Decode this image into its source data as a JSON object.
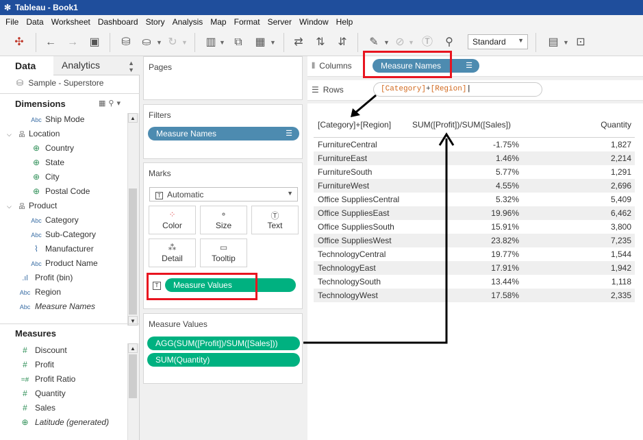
{
  "window": {
    "title": "Tableau - Book1"
  },
  "menu": [
    "File",
    "Data",
    "Worksheet",
    "Dashboard",
    "Story",
    "Analysis",
    "Map",
    "Format",
    "Server",
    "Window",
    "Help"
  ],
  "toolbar": {
    "view_mode": "Standard"
  },
  "data_pane": {
    "tab_data": "Data",
    "tab_analytics": "Analytics",
    "datasource": "Sample - Superstore",
    "dimensions_title": "Dimensions",
    "measures_title": "Measures",
    "dimensions": [
      {
        "label": "Ship Mode",
        "icon": "Abc"
      },
      {
        "label": "Location",
        "icon": "hierarchy"
      },
      {
        "label": "Country",
        "icon": "globe"
      },
      {
        "label": "State",
        "icon": "globe"
      },
      {
        "label": "City",
        "icon": "globe"
      },
      {
        "label": "Postal Code",
        "icon": "globe"
      },
      {
        "label": "Product",
        "icon": "hierarchy"
      },
      {
        "label": "Category",
        "icon": "Abc"
      },
      {
        "label": "Sub-Category",
        "icon": "Abc"
      },
      {
        "label": "Manufacturer",
        "icon": "paperclip"
      },
      {
        "label": "Product Name",
        "icon": "Abc"
      },
      {
        "label": "Profit (bin)",
        "icon": "bin"
      },
      {
        "label": "Region",
        "icon": "Abc"
      },
      {
        "label": "Measure Names",
        "icon": "Abc"
      }
    ],
    "measures": [
      {
        "label": "Discount",
        "icon": "#"
      },
      {
        "label": "Profit",
        "icon": "#"
      },
      {
        "label": "Profit Ratio",
        "icon": "=#"
      },
      {
        "label": "Quantity",
        "icon": "#"
      },
      {
        "label": "Sales",
        "icon": "#"
      },
      {
        "label": "Latitude (generated)",
        "icon": "globe"
      }
    ]
  },
  "cards": {
    "pages_title": "Pages",
    "filters_title": "Filters",
    "filter_pill": "Measure Names",
    "marks_title": "Marks",
    "marks_type": "Automatic",
    "mark_buttons": [
      "Color",
      "Size",
      "Text",
      "Detail",
      "Tooltip"
    ],
    "marks_pill": "Measure Values",
    "measure_values_title": "Measure Values",
    "measure_value_pills": [
      "AGG(SUM([Profit])/SUM([Sales]))",
      "SUM(Quantity)"
    ]
  },
  "shelves": {
    "columns_label": "Columns",
    "columns_pill": "Measure Names",
    "rows_label": "Rows",
    "rows_calc_a": "[Category]",
    "rows_calc_op": "+",
    "rows_calc_b": "[Region]"
  },
  "table": {
    "headers": [
      "[Category]+[Region]",
      "SUM([Profit])/SUM([Sales])",
      "Quantity"
    ],
    "rows": [
      [
        "FurnitureCentral",
        "-1.75%",
        "1,827"
      ],
      [
        "FurnitureEast",
        "1.46%",
        "2,214"
      ],
      [
        "FurnitureSouth",
        "5.77%",
        "1,291"
      ],
      [
        "FurnitureWest",
        "4.55%",
        "2,696"
      ],
      [
        "Office SuppliesCentral",
        "5.32%",
        "5,409"
      ],
      [
        "Office SuppliesEast",
        "19.96%",
        "6,462"
      ],
      [
        "Office SuppliesSouth",
        "15.91%",
        "3,800"
      ],
      [
        "Office SuppliesWest",
        "23.82%",
        "7,235"
      ],
      [
        "TechnologyCentral",
        "19.77%",
        "1,544"
      ],
      [
        "TechnologyEast",
        "17.91%",
        "1,942"
      ],
      [
        "TechnologySouth",
        "13.44%",
        "1,118"
      ],
      [
        "TechnologyWest",
        "17.58%",
        "2,335"
      ]
    ]
  },
  "colors": {
    "title_bar": "#1f4e9c",
    "dimension_pill": "#4d8bb0",
    "measure_pill": "#00b180",
    "annotation_red": "#e8141f"
  }
}
